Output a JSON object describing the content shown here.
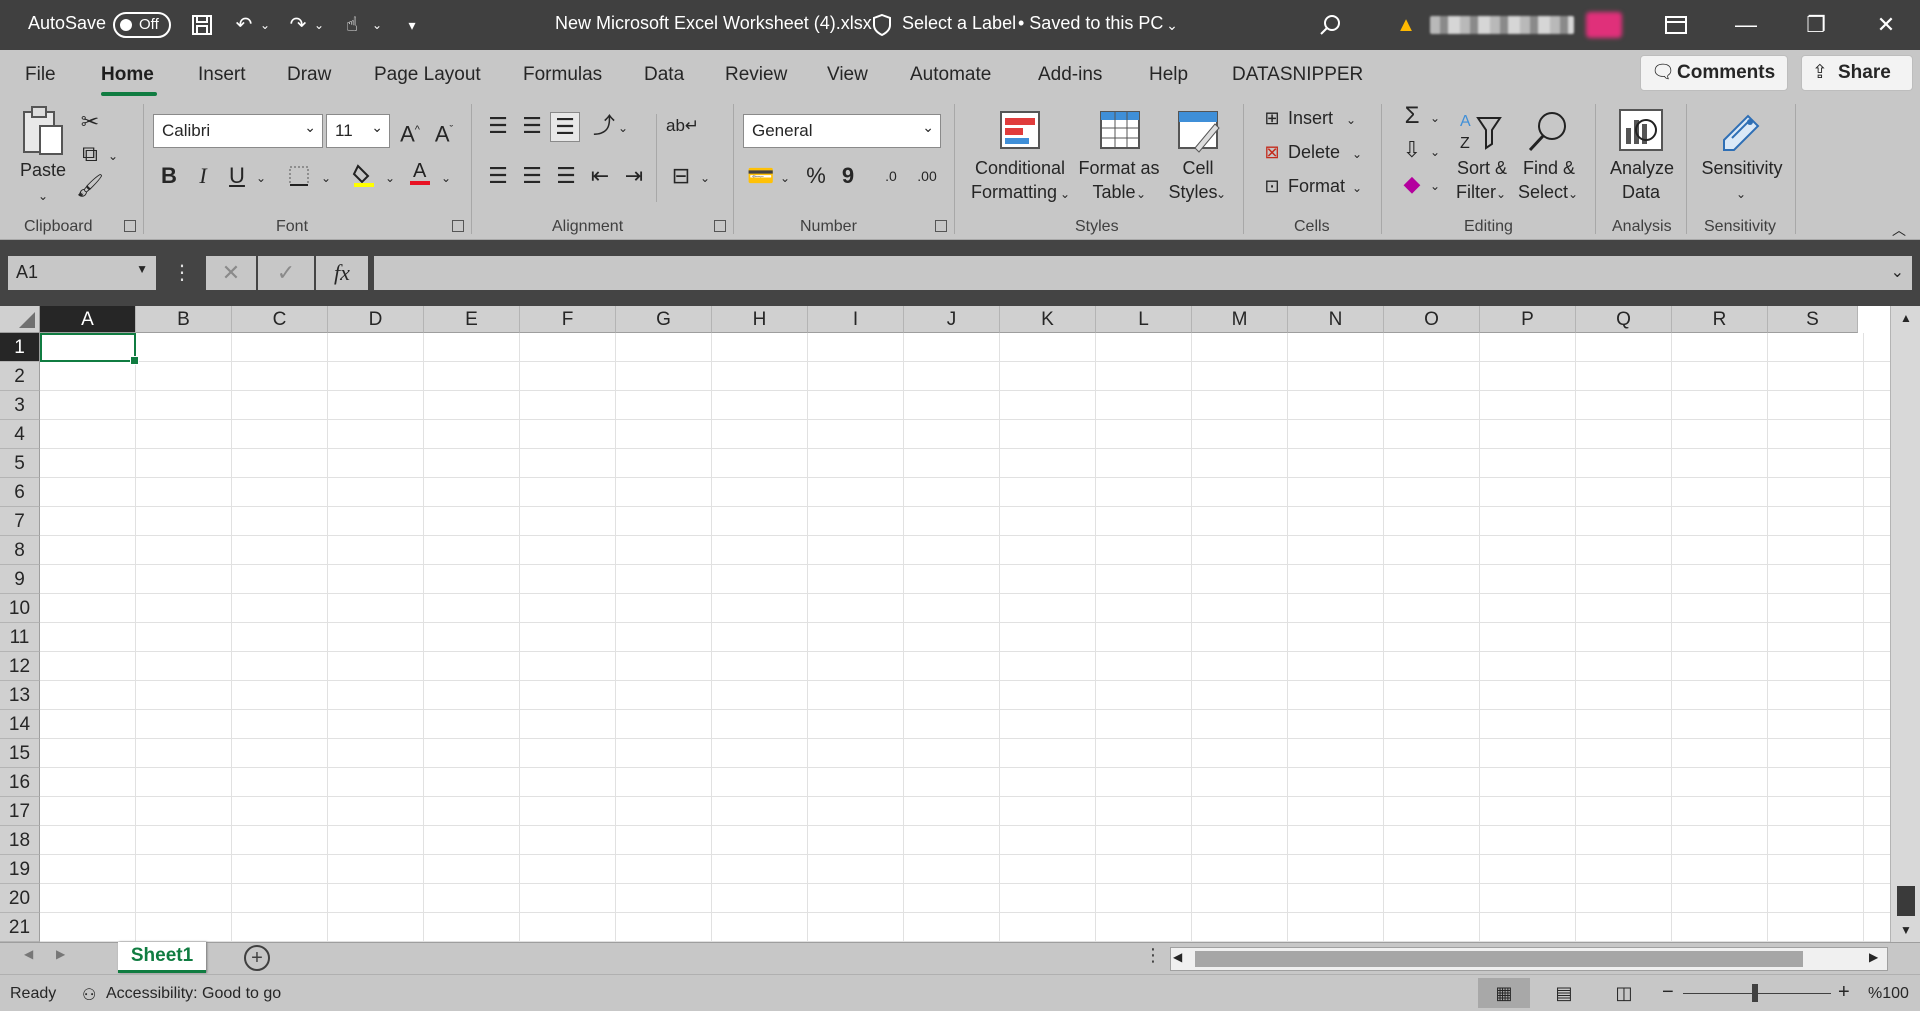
{
  "title_bar": {
    "autosave_label": "AutoSave",
    "autosave_state": "Off",
    "document_title": "New Microsoft Excel Worksheet (4).xlsx",
    "label_status": "Select a Label",
    "save_status": "• Saved to this PC",
    "warning_icon": "warning-icon"
  },
  "tabs": [
    "File",
    "Home",
    "Insert",
    "Draw",
    "Page Layout",
    "Formulas",
    "Data",
    "Review",
    "View",
    "Automate",
    "Add-ins",
    "Help",
    "DATASNIPPER"
  ],
  "active_tab": "Home",
  "header_buttons": {
    "comments": "Comments",
    "share": "Share"
  },
  "ribbon": {
    "clipboard": {
      "paste": "Paste",
      "label": "Clipboard"
    },
    "font": {
      "name": "Calibri",
      "size": "11",
      "label": "Font",
      "bold": "B",
      "italic": "I",
      "underline": "U"
    },
    "alignment": {
      "label": "Alignment"
    },
    "number": {
      "format": "General",
      "label": "Number",
      "percent": "%",
      "comma": "9",
      "inc_decimal": ".0",
      "dec_decimal": ".00"
    },
    "styles": {
      "conditional_line1": "Conditional",
      "conditional_line2": "Formatting",
      "format_table_line1": "Format as",
      "format_table_line2": "Table",
      "cell_styles_line1": "Cell",
      "cell_styles_line2": "Styles",
      "label": "Styles"
    },
    "cells": {
      "insert": "Insert",
      "delete": "Delete",
      "format": "Format",
      "label": "Cells"
    },
    "editing": {
      "sort_line1": "Sort &",
      "sort_line2": "Filter",
      "find_line1": "Find &",
      "find_line2": "Select",
      "label": "Editing"
    },
    "analysis": {
      "analyze_line1": "Analyze",
      "analyze_line2": "Data",
      "label": "Analysis"
    },
    "sensitivity": {
      "button": "Sensitivity",
      "label": "Sensitivity"
    }
  },
  "formula_bar": {
    "name_box": "A1",
    "fx": "fx",
    "value": ""
  },
  "columns": [
    "A",
    "B",
    "C",
    "D",
    "E",
    "F",
    "G",
    "H",
    "I",
    "J",
    "K",
    "L",
    "M",
    "N",
    "O",
    "P",
    "Q",
    "R",
    "S"
  ],
  "rows": [
    "1",
    "2",
    "3",
    "4",
    "5",
    "6",
    "7",
    "8",
    "9",
    "10",
    "11",
    "12",
    "13",
    "14",
    "15",
    "16",
    "17",
    "18",
    "19",
    "20",
    "21"
  ],
  "selected_cell": "A1",
  "sheets": [
    "Sheet1"
  ],
  "status_bar": {
    "ready": "Ready",
    "accessibility": "Accessibility: Good to go",
    "zoom": "%100"
  },
  "colors": {
    "accent": "#107c41",
    "titlebar": "#404040",
    "ribbon": "#c7c7c7"
  }
}
